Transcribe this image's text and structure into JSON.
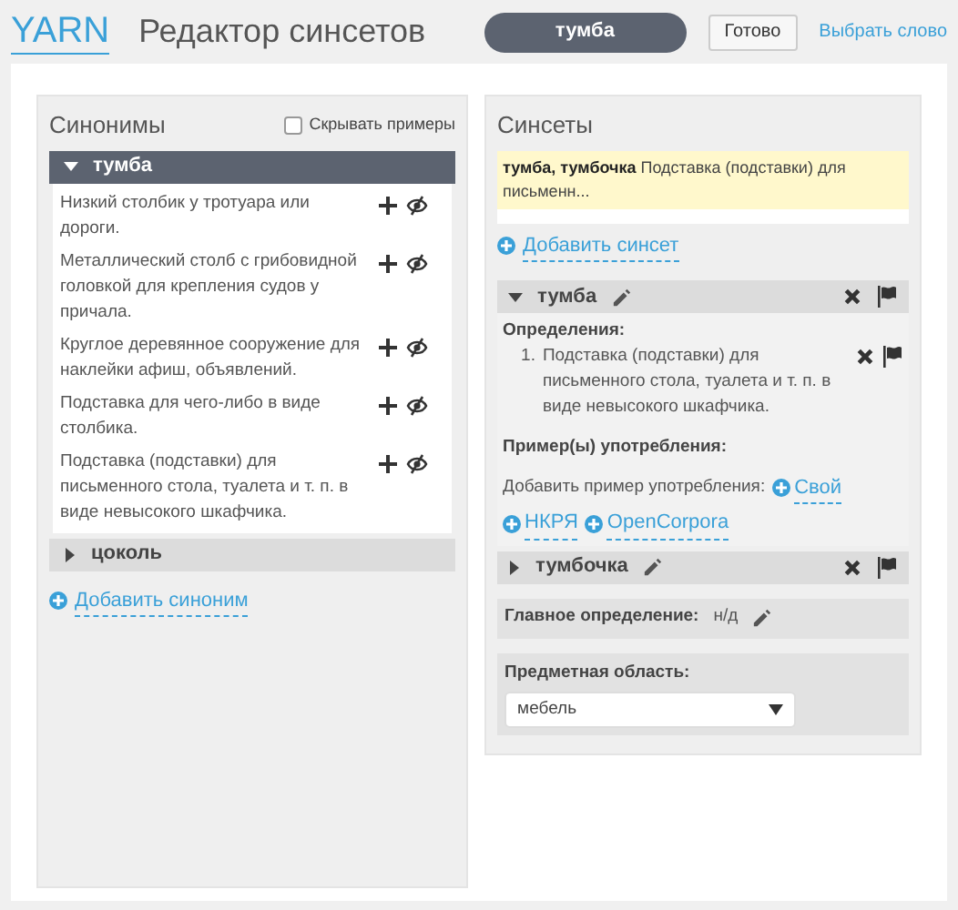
{
  "header": {
    "logo": "YARN",
    "title": "Редактор синсетов",
    "word_field": {
      "value": "тумба"
    },
    "done_button": "Готово",
    "choose_link": "Выбрать слово"
  },
  "synonyms": {
    "title": "Синонимы",
    "hide_examples": {
      "label": "Скрывать примеры",
      "checked": false
    },
    "groups": [
      {
        "word": "тумба",
        "expanded": true,
        "definitions": [
          "Низкий столбик у тротуара или дороги.",
          "Металлический столб с грибовидной головкой для крепления судов у причала.",
          "Круглое деревянное сооружение для наклейки афиш, объявлений.",
          "Подставка для чего-либо в виде столбика.",
          "Подставка (подставки) для письменного стола, туалета и т. п. в виде невысокого шкафчика."
        ]
      },
      {
        "word": "цоколь",
        "expanded": false
      }
    ],
    "add_link": "Добавить синоним"
  },
  "synsets": {
    "title": "Синсеты",
    "list": [
      {
        "words": "тумба, тумбочка",
        "gloss": "Подставка (подставки) для письменн...",
        "selected": true
      }
    ],
    "add_link": "Добавить синсет",
    "words": [
      {
        "word": "тумба",
        "expanded": true,
        "definitions_label": "Определения:",
        "definitions": [
          {
            "number": "1.",
            "text": "Подставка (подставки) для письменного стола, туалета и т. п. в виде невысокого шкафчика."
          }
        ],
        "examples_label": "Пример(ы) употребления:",
        "add_example_label": "Добавить пример употребления:",
        "example_links": [
          "Свой",
          "НКРЯ",
          "OpenCorpora"
        ]
      },
      {
        "word": "тумбочка",
        "expanded": false
      }
    ],
    "main_definition": {
      "label": "Главное определение:",
      "value": "н/д"
    },
    "domain": {
      "label": "Предметная область:",
      "value": "мебель"
    }
  }
}
